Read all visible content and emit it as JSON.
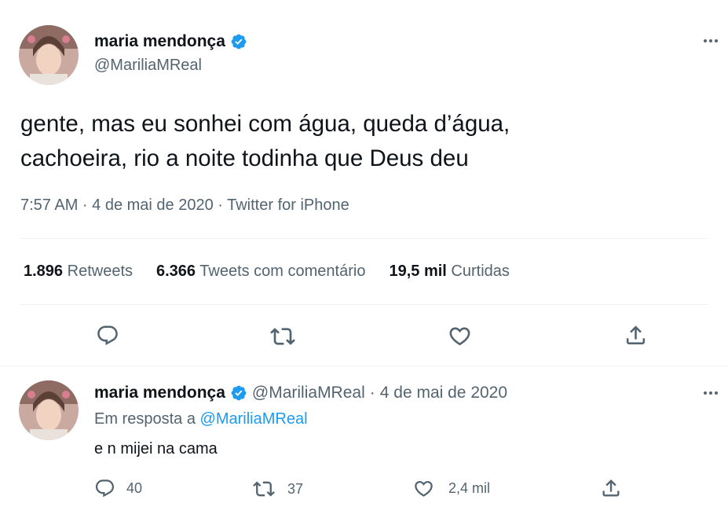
{
  "main_tweet": {
    "author_name": "maria mendonça",
    "author_handle": "@MariliaMReal",
    "text_line1": "gente, mas eu sonhei com água, queda d’água,",
    "text_line2": "cachoeira, rio a noite todinha que Deus deu",
    "meta": "7:57 AM · 4 de mai de 2020 · Twitter for iPhone",
    "stats": [
      {
        "count": "1.896",
        "label": "Retweets"
      },
      {
        "count": "6.366",
        "label": "Tweets com comentário"
      },
      {
        "count": "19,5 mil",
        "label": "Curtidas"
      }
    ]
  },
  "reply_tweet": {
    "author_name": "maria mendonça",
    "author_handle": "@MariliaMReal",
    "separator": "·",
    "date": "4 de mai de 2020",
    "reply_prefix": "Em resposta a",
    "reply_to": "@MariliaMReal",
    "text": "e n mijei na cama",
    "reply_count": "40",
    "retweet_count": "37",
    "like_count": "2,4 mil"
  },
  "colors": {
    "accent": "#1d9bf0",
    "text": "#0f1419",
    "muted": "#536471",
    "divider": "#eff3f4"
  },
  "icons": [
    "verified-badge-icon",
    "more-icon",
    "reply-icon",
    "retweet-icon",
    "like-icon",
    "share-icon"
  ]
}
